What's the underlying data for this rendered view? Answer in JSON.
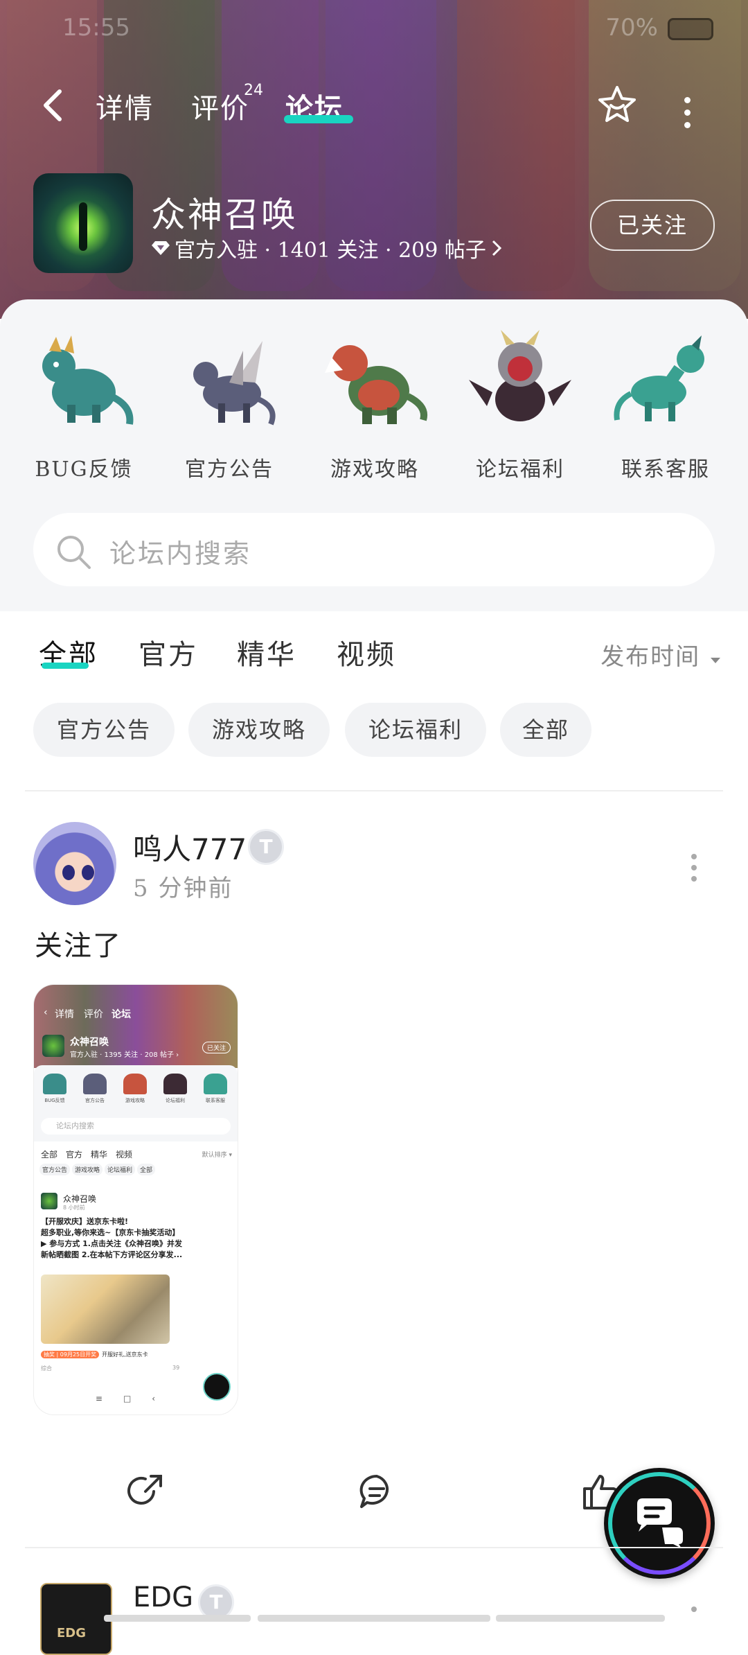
{
  "status": {
    "time": "15:55",
    "battery": "70%"
  },
  "nav": {
    "tabs": [
      {
        "label": "详情"
      },
      {
        "label": "评价",
        "badge": "24"
      },
      {
        "label": "论坛"
      }
    ],
    "active_tab": "论坛"
  },
  "game": {
    "title": "众神召唤",
    "meta": "官方入驻 · 1401 关注 · 209 帖子",
    "follow_label": "已关注"
  },
  "categories": [
    {
      "label": "BUG反馈",
      "color": "#3a8d8a"
    },
    {
      "label": "官方公告",
      "color": "#5b5e7a"
    },
    {
      "label": "游戏攻略",
      "color": "#c7543e"
    },
    {
      "label": "论坛福利",
      "color": "#3c2a34"
    },
    {
      "label": "联系客服",
      "color": "#3aa191"
    }
  ],
  "search": {
    "placeholder": "论坛内搜索"
  },
  "filter_tabs": [
    "全部",
    "官方",
    "精华",
    "视频"
  ],
  "sort_label": "发布时间",
  "chips": [
    "官方公告",
    "游戏攻略",
    "论坛福利",
    "全部"
  ],
  "post": {
    "username": "鸣人777",
    "level": "T",
    "time": "5 分钟前",
    "text": "关注了",
    "screenshot": {
      "tabs": [
        "详情",
        "评价",
        "论坛"
      ],
      "game_title": "众神召唤",
      "game_meta": "官方入驻 · 1395 关注 · 208 帖子 ›",
      "follow": "已关注",
      "cats": [
        "BUG反馈",
        "官方公告",
        "游戏攻略",
        "论坛福利",
        "联系客服"
      ],
      "search": "论坛内搜索",
      "filter_tabs": [
        "全部",
        "官方",
        "精华",
        "视频"
      ],
      "sort": "默认排序 ▾",
      "chips": [
        "官方公告",
        "游戏攻略",
        "论坛福利",
        "全部"
      ],
      "post_name": "众神召唤",
      "post_time": "8 小时前",
      "post_body": "【开服欢庆】送京东卡啦!\n超多职业,等你来选~【京东卡抽奖活动】\n▶ 参与方式 1.点击关注《众神召唤》并发\n新帖晒截图 2.在本帖下方评论区分享发...",
      "tag_badge": "抽奖 | 09月25日开奖",
      "tag_text": "开服好礼,送京东卡",
      "foot_left": "综合",
      "comment_count": "39"
    }
  },
  "next_post": {
    "username": "EDG",
    "level": "T",
    "avatar_text": "EDG"
  },
  "colors": {
    "accent": "#19d4c1"
  }
}
